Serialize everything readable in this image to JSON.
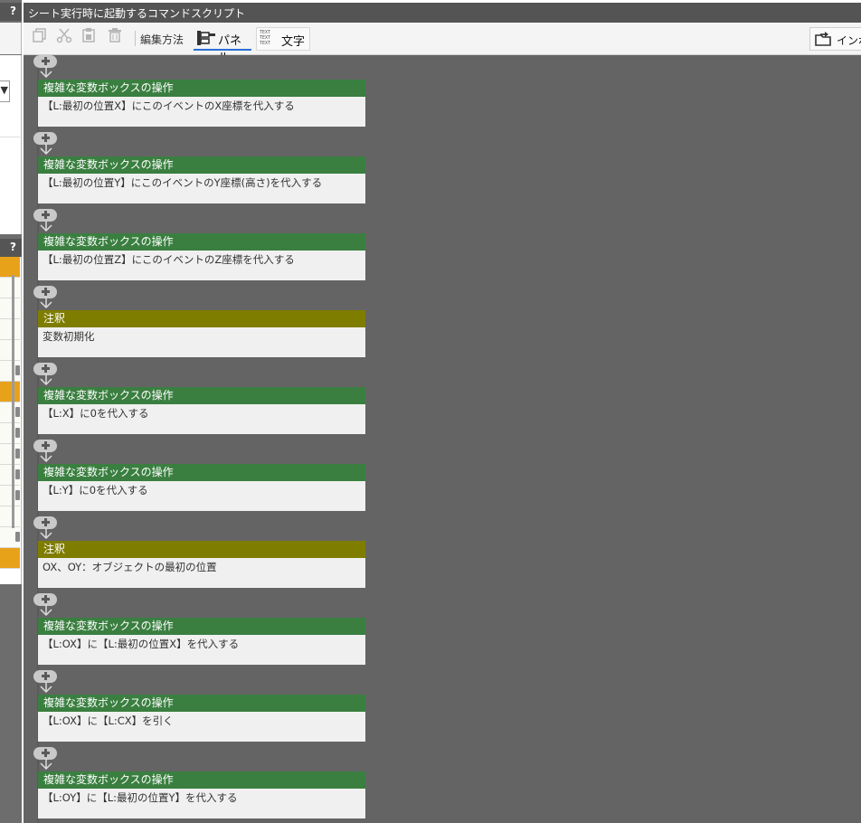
{
  "left_panel": {
    "help_top": "?",
    "help_mid": "?"
  },
  "window": {
    "title": "シート実行時に起動するコマンドスクリプト"
  },
  "toolbar": {
    "edit_method_label": "編集方法",
    "panel_label": "パネル",
    "text_label": "文字",
    "text_icon": "TEXT TEXT TEXT",
    "import_label": "インポ"
  },
  "icons": {
    "copy": "copy-icon",
    "cut": "scissors-icon",
    "paste": "paste-icon",
    "delete": "trash-icon",
    "panel": "panel-icon",
    "import": "folder-import-icon",
    "add": "plus-icon"
  },
  "colors": {
    "variable_header": "#3a7f40",
    "comment_header": "#7f7d00",
    "canvas_bg": "#646464",
    "active_tab_underline": "#2a6fd6"
  },
  "commands": [
    {
      "kind": "variable",
      "title": "複雑な変数ボックスの操作",
      "body": "【L:最初の位置X】にこのイベントのX座標を代入する"
    },
    {
      "kind": "variable",
      "title": "複雑な変数ボックスの操作",
      "body": "【L:最初の位置Y】にこのイベントのY座標(高さ)を代入する"
    },
    {
      "kind": "variable",
      "title": "複雑な変数ボックスの操作",
      "body": "【L:最初の位置Z】にこのイベントのZ座標を代入する"
    },
    {
      "kind": "comment",
      "title": "注釈",
      "body": "変数初期化"
    },
    {
      "kind": "variable",
      "title": "複雑な変数ボックスの操作",
      "body": "【L:X】に0を代入する"
    },
    {
      "kind": "variable",
      "title": "複雑な変数ボックスの操作",
      "body": "【L:Y】に0を代入する"
    },
    {
      "kind": "comment",
      "title": "注釈",
      "body": "OX、OY：オブジェクトの最初の位置"
    },
    {
      "kind": "variable",
      "title": "複雑な変数ボックスの操作",
      "body": "【L:OX】に【L:最初の位置X】を代入する"
    },
    {
      "kind": "variable",
      "title": "複雑な変数ボックスの操作",
      "body": "【L:OX】に【L:CX】を引く"
    },
    {
      "kind": "variable",
      "title": "複雑な変数ボックスの操作",
      "body": "【L:OY】に【L:最初の位置Y】を代入する"
    }
  ]
}
